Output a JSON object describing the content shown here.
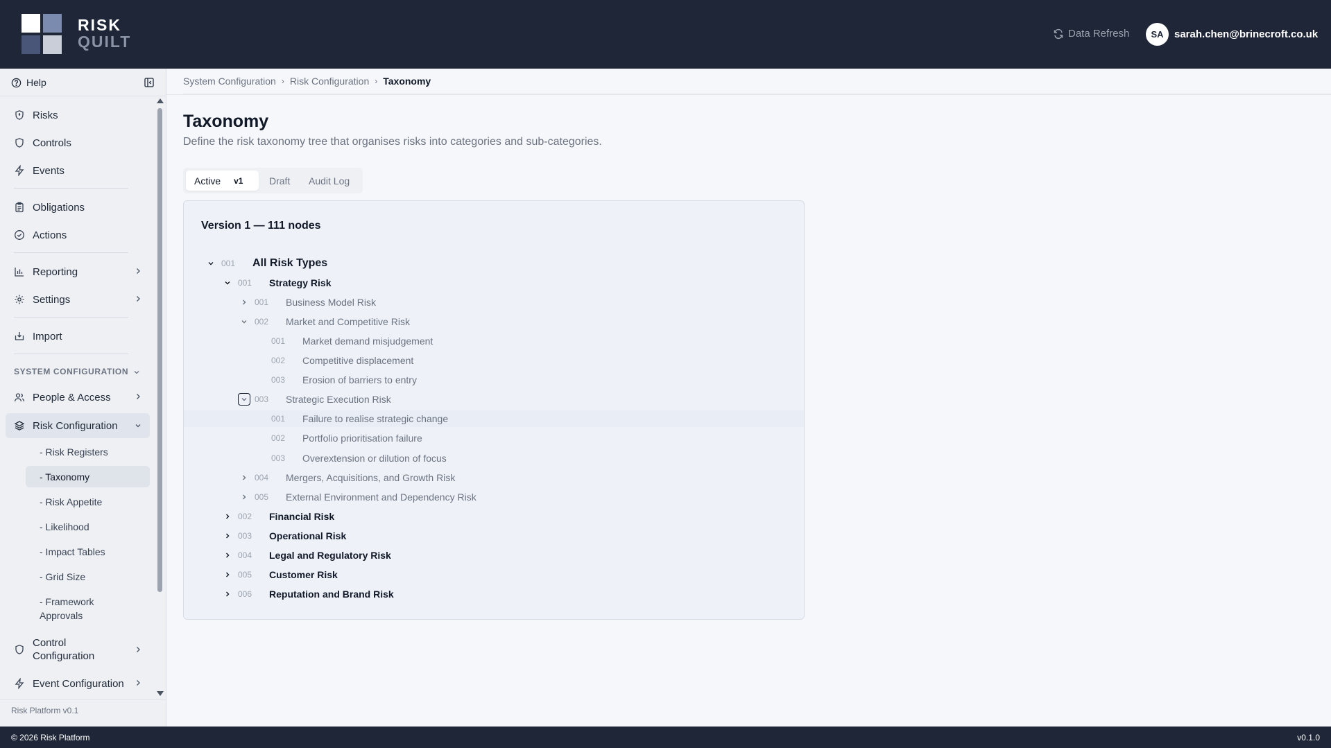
{
  "brand": {
    "line1": "RISK",
    "line2": "QUILT"
  },
  "header": {
    "refresh_label": "Data Refresh",
    "avatar_initials": "SA",
    "user_email": "sarah.chen@brinecroft.co.uk"
  },
  "sidebar": {
    "help_label": "Help",
    "items": {
      "risks": "Risks",
      "controls": "Controls",
      "events": "Events",
      "obligations": "Obligations",
      "actions": "Actions",
      "reporting": "Reporting",
      "settings": "Settings",
      "import": "Import",
      "people": "People & Access",
      "risk_config": "Risk Configuration",
      "control_config": "Control Configuration",
      "event_config": "Event Configuration"
    },
    "section_label": "SYSTEM CONFIGURATION",
    "sub_items": [
      "- Risk Registers",
      "- Taxonomy",
      "- Risk Appetite",
      "- Likelihood",
      "- Impact Tables",
      "- Grid Size",
      "- Framework Approvals"
    ],
    "version_text": "Risk Platform v0.1"
  },
  "breadcrumb": [
    "System Configuration",
    "Risk Configuration",
    "Taxonomy"
  ],
  "breadcrumb_sep": "›",
  "page": {
    "title": "Taxonomy",
    "subtitle": "Define the risk taxonomy tree that organises risks into categories and sub-categories."
  },
  "tabs": {
    "active_label": "Active",
    "active_version": "v1",
    "draft_label": "Draft",
    "audit_label": "Audit Log"
  },
  "card": {
    "title": "Version 1 — 111 nodes"
  },
  "tree": [
    {
      "code": "001",
      "label": "All Risk Types",
      "level": 0,
      "state": "expanded"
    },
    {
      "code": "001",
      "label": "Strategy Risk",
      "level": 1,
      "state": "expanded"
    },
    {
      "code": "001",
      "label": "Business Model Risk",
      "level": 2,
      "state": "collapsed"
    },
    {
      "code": "002",
      "label": "Market and Competitive Risk",
      "level": 2,
      "state": "expanded"
    },
    {
      "code": "001",
      "label": "Market demand misjudgement",
      "level": 3,
      "state": "leaf"
    },
    {
      "code": "002",
      "label": "Competitive displacement",
      "level": 3,
      "state": "leaf"
    },
    {
      "code": "003",
      "label": "Erosion of barriers to entry",
      "level": 3,
      "state": "leaf"
    },
    {
      "code": "003",
      "label": "Strategic Execution Risk",
      "level": 2,
      "state": "expanded-focused"
    },
    {
      "code": "001",
      "label": "Failure to realise strategic change",
      "level": 3,
      "state": "leaf",
      "highlight": true
    },
    {
      "code": "002",
      "label": "Portfolio prioritisation failure",
      "level": 3,
      "state": "leaf"
    },
    {
      "code": "003",
      "label": "Overextension or dilution of focus",
      "level": 3,
      "state": "leaf"
    },
    {
      "code": "004",
      "label": "Mergers, Acquisitions, and Growth Risk",
      "level": 2,
      "state": "collapsed"
    },
    {
      "code": "005",
      "label": "External Environment and Dependency Risk",
      "level": 2,
      "state": "collapsed"
    },
    {
      "code": "002",
      "label": "Financial Risk",
      "level": 1,
      "state": "collapsed"
    },
    {
      "code": "003",
      "label": "Operational Risk",
      "level": 1,
      "state": "collapsed"
    },
    {
      "code": "004",
      "label": "Legal and Regulatory Risk",
      "level": 1,
      "state": "collapsed"
    },
    {
      "code": "005",
      "label": "Customer Risk",
      "level": 1,
      "state": "collapsed"
    },
    {
      "code": "006",
      "label": "Reputation and Brand Risk",
      "level": 1,
      "state": "collapsed"
    }
  ],
  "footer": {
    "copyright": "© 2026 Risk Platform",
    "version": "v0.1.0"
  },
  "colors": {
    "header_bg": "#1e2638",
    "sidebar_bg": "#eef0f4",
    "card_bg": "#eef2f8",
    "accent": "#7b8bb0"
  }
}
